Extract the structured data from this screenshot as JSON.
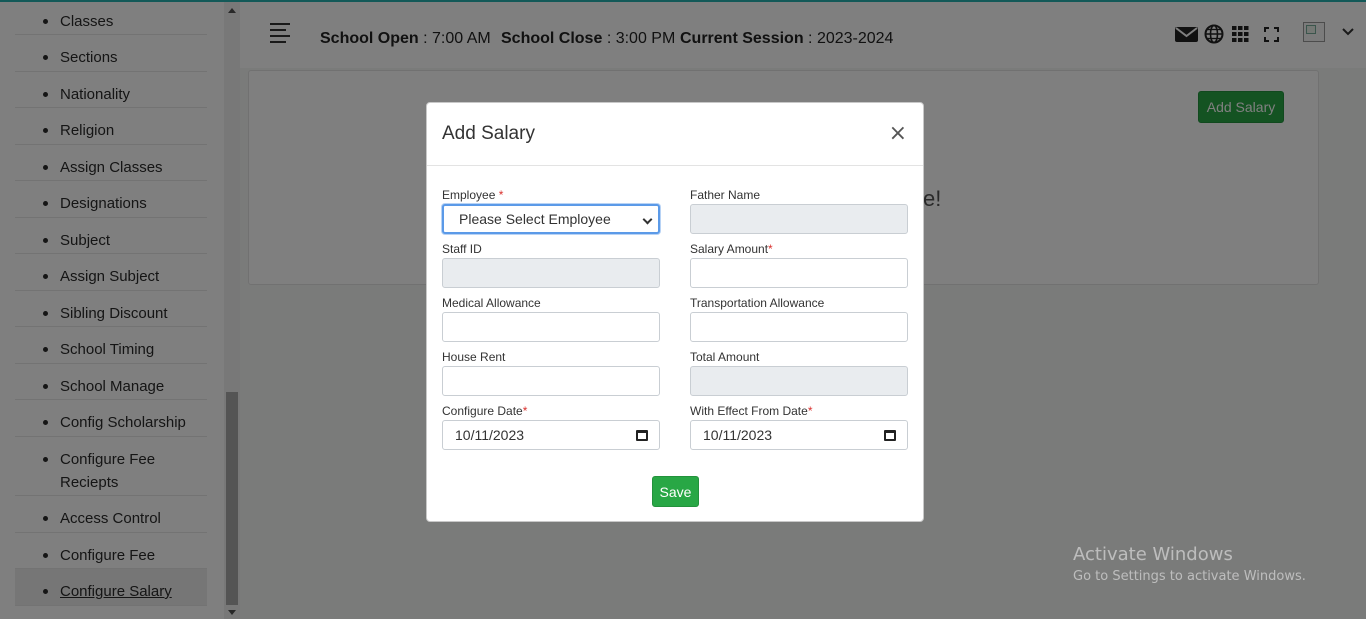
{
  "sidebar": {
    "items": [
      {
        "label": "Classes"
      },
      {
        "label": "Sections"
      },
      {
        "label": "Nationality"
      },
      {
        "label": "Religion"
      },
      {
        "label": "Assign Classes"
      },
      {
        "label": "Designations"
      },
      {
        "label": "Subject"
      },
      {
        "label": "Assign Subject"
      },
      {
        "label": "Sibling Discount"
      },
      {
        "label": "School Timing"
      },
      {
        "label": "School Manage"
      },
      {
        "label": "Config Scholarship"
      },
      {
        "label": "Configure Fee Reciepts"
      },
      {
        "label": "Access Control"
      },
      {
        "label": "Configure Fee"
      },
      {
        "label": "Configure Salary"
      }
    ],
    "active": "Configure Salary"
  },
  "header": {
    "school_open_label": "School Open",
    "school_open_value": ": 7:00 AM",
    "school_close_label": "School Close",
    "school_close_value": ": 3:00 PM",
    "session_label": "Current Session",
    "session_value": ": 2023-2024",
    "icons": [
      "menu-icon",
      "mail-icon",
      "globe-icon",
      "grid-icon",
      "fullscreen-icon",
      "avatar",
      "chevron-down-icon"
    ]
  },
  "page": {
    "add_salary_button": "Add Salary",
    "partial_text": "se!"
  },
  "modal": {
    "title": "Add Salary",
    "close_symbol": "×",
    "fields": {
      "employee_label": "Employee",
      "employee_value": "Please Select Employee",
      "father_name_label": "Father Name",
      "staff_id_label": "Staff ID",
      "salary_amount_label": "Salary Amount",
      "medical_allowance_label": "Medical Allowance",
      "transportation_allowance_label": "Transportation Allowance",
      "house_rent_label": "House Rent",
      "total_amount_label": "Total Amount",
      "configure_date_label": "Configure Date",
      "configure_date_value": "10/11/2023",
      "effect_date_label": "With Effect From Date",
      "effect_date_value": "10/11/2023"
    },
    "required_marker": "*",
    "save_button": "Save"
  },
  "watermark": {
    "line1": "Activate Windows",
    "line2": "Go to Settings to activate Windows."
  },
  "colors": {
    "accent_green": "#28a745",
    "top_line": "#26b3b0",
    "required_red": "#d9302d"
  }
}
